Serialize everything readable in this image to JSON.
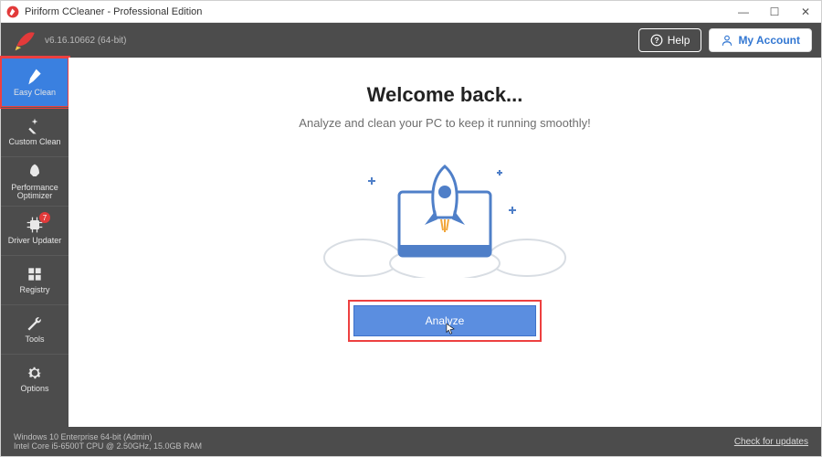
{
  "titlebar": {
    "title": "Piriform CCleaner - Professional Edition"
  },
  "header": {
    "version": "v6.16.10662 (64-bit)",
    "help_label": "Help",
    "account_label": "My Account"
  },
  "sidebar": {
    "items": [
      {
        "label": "Easy Clean"
      },
      {
        "label": "Custom Clean"
      },
      {
        "label": "Performance Optimizer"
      },
      {
        "label": "Driver Updater",
        "badge": "7"
      },
      {
        "label": "Registry"
      },
      {
        "label": "Tools"
      },
      {
        "label": "Options"
      }
    ]
  },
  "main": {
    "heading": "Welcome back...",
    "subheading": "Analyze and clean your PC to keep it running smoothly!",
    "analyze_label": "Analyze"
  },
  "statusbar": {
    "os_line": "Windows 10 Enterprise 64-bit (Admin)",
    "hw_line": "Intel Core i5-6500T CPU @ 2.50GHz, 15.0GB RAM",
    "check_updates": "Check for updates"
  },
  "colors": {
    "brand_blue": "#3a80e0",
    "highlight_red": "#ed4040"
  }
}
